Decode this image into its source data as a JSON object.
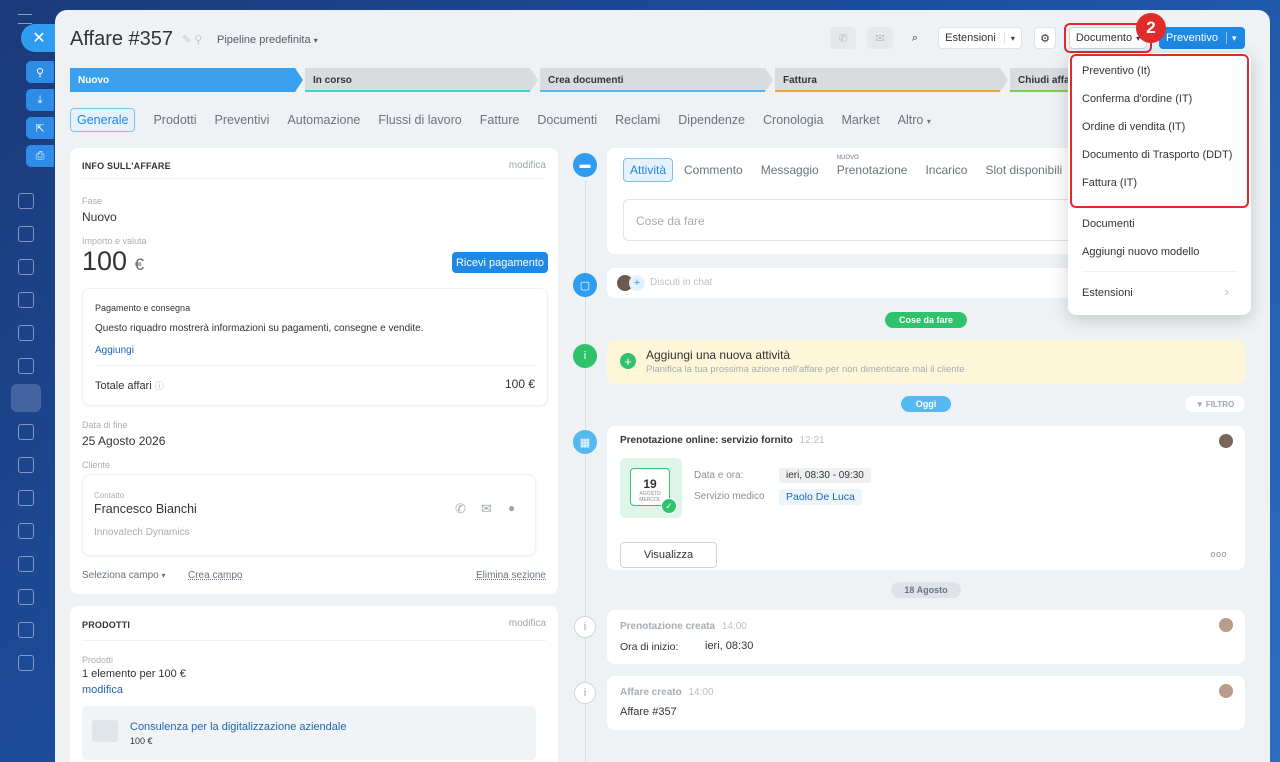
{
  "deal": {
    "title": "Affare #357",
    "pipeline": "Pipeline predefinita"
  },
  "toolbar": {
    "extensions_label": "Estensioni",
    "document_label": "Documento",
    "primary_label": "Preventivo"
  },
  "callout_number": "2",
  "stages": [
    "Nuovo",
    "In corso",
    "Crea documenti",
    "Fattura",
    "Chiudi affa"
  ],
  "tabs": [
    "Generale",
    "Prodotti",
    "Preventivi",
    "Automazione",
    "Flussi di lavoro",
    "Fatture",
    "Documenti",
    "Reclami",
    "Dipendenze",
    "Cronologia",
    "Market",
    "Altro"
  ],
  "info": {
    "section_title": "INFO SULL'AFFARE",
    "edit_label": "modifica",
    "stage_label": "Fase",
    "stage_value": "Nuovo",
    "amount_label": "Importo e valuta",
    "amount_value": "100",
    "currency": "€",
    "pay_button": "Ricevi pagamento",
    "payment_title": "Pagamento e consegna",
    "payment_desc": "Questo riquadro mostrerà informazioni su pagamenti, consegne e vendite.",
    "add_link": "Aggiungi",
    "total_label": "Totale affari",
    "total_value": "100 €",
    "end_date_label": "Data di fine",
    "end_date_value": "25 Agosto 2026",
    "client_label": "Cliente",
    "contact_label": "Contatto",
    "contact_name": "Francesco Bianchi",
    "company": "Innovatech Dynamics",
    "select_field": "Seleziona campo",
    "create_field": "Crea campo",
    "delete_section": "Elimina sezione"
  },
  "products": {
    "section_title": "PRODOTTI",
    "edit_label": "modifica",
    "label": "Prodotti",
    "summary": "1 elemento per 100 €",
    "edit_link": "modifica",
    "item_name": "Consulenza per la digitalizzazione aziendale",
    "item_price": "100 €"
  },
  "activity": {
    "tabs": [
      "Attività",
      "Commento",
      "Messaggio",
      "Prenotazione",
      "Incarico",
      "Slot disponibili"
    ],
    "new_badge": "NUOVO",
    "todo_placeholder": "Cose da fare",
    "chat_placeholder": "Discuti in chat",
    "todo_pill": "Cose da fare",
    "add_title": "Aggiungi una nuova attività",
    "add_subtitle": "Pianifica la tua prossima azione nell'affare per non dimenticare mai il cliente",
    "today_pill": "Oggi",
    "filter_label": "FILTRO"
  },
  "booking": {
    "title": "Prenotazione online: servizio fornito",
    "time": "12:21",
    "date_label": "Data e ora:",
    "date_value": "ieri, 08:30 - 09:30",
    "service_label": "Servizio medico",
    "service_value": "Paolo De Luca",
    "cal_day": "19",
    "cal_month": "AGOSTO",
    "cal_weekday": "MERCOL",
    "view_button": "Visualizza",
    "more": "ooo"
  },
  "history": {
    "date_pill": "18 Agosto",
    "created_booking_title": "Prenotazione creata",
    "created_booking_time": "14:00",
    "start_label": "Ora di inizio:",
    "start_value": "ieri, 08:30",
    "deal_created_title": "Affare creato",
    "deal_created_time": "14:00",
    "deal_created_value": "Affare #357"
  },
  "dropdown": {
    "templates": [
      "Preventivo (It)",
      "Conferma d'ordine (IT)",
      "Ordine di vendita (IT)",
      "Documento di Trasporto (DDT)",
      "Fattura (IT)"
    ],
    "documents": "Documenti",
    "add_template": "Aggiungi nuovo modello",
    "extensions": "Estensioni"
  },
  "colors": {
    "accent": "#1e88e5",
    "stage_new": "#3aa0ee",
    "highlight": "#e12a2a",
    "success": "#2fc26b"
  }
}
